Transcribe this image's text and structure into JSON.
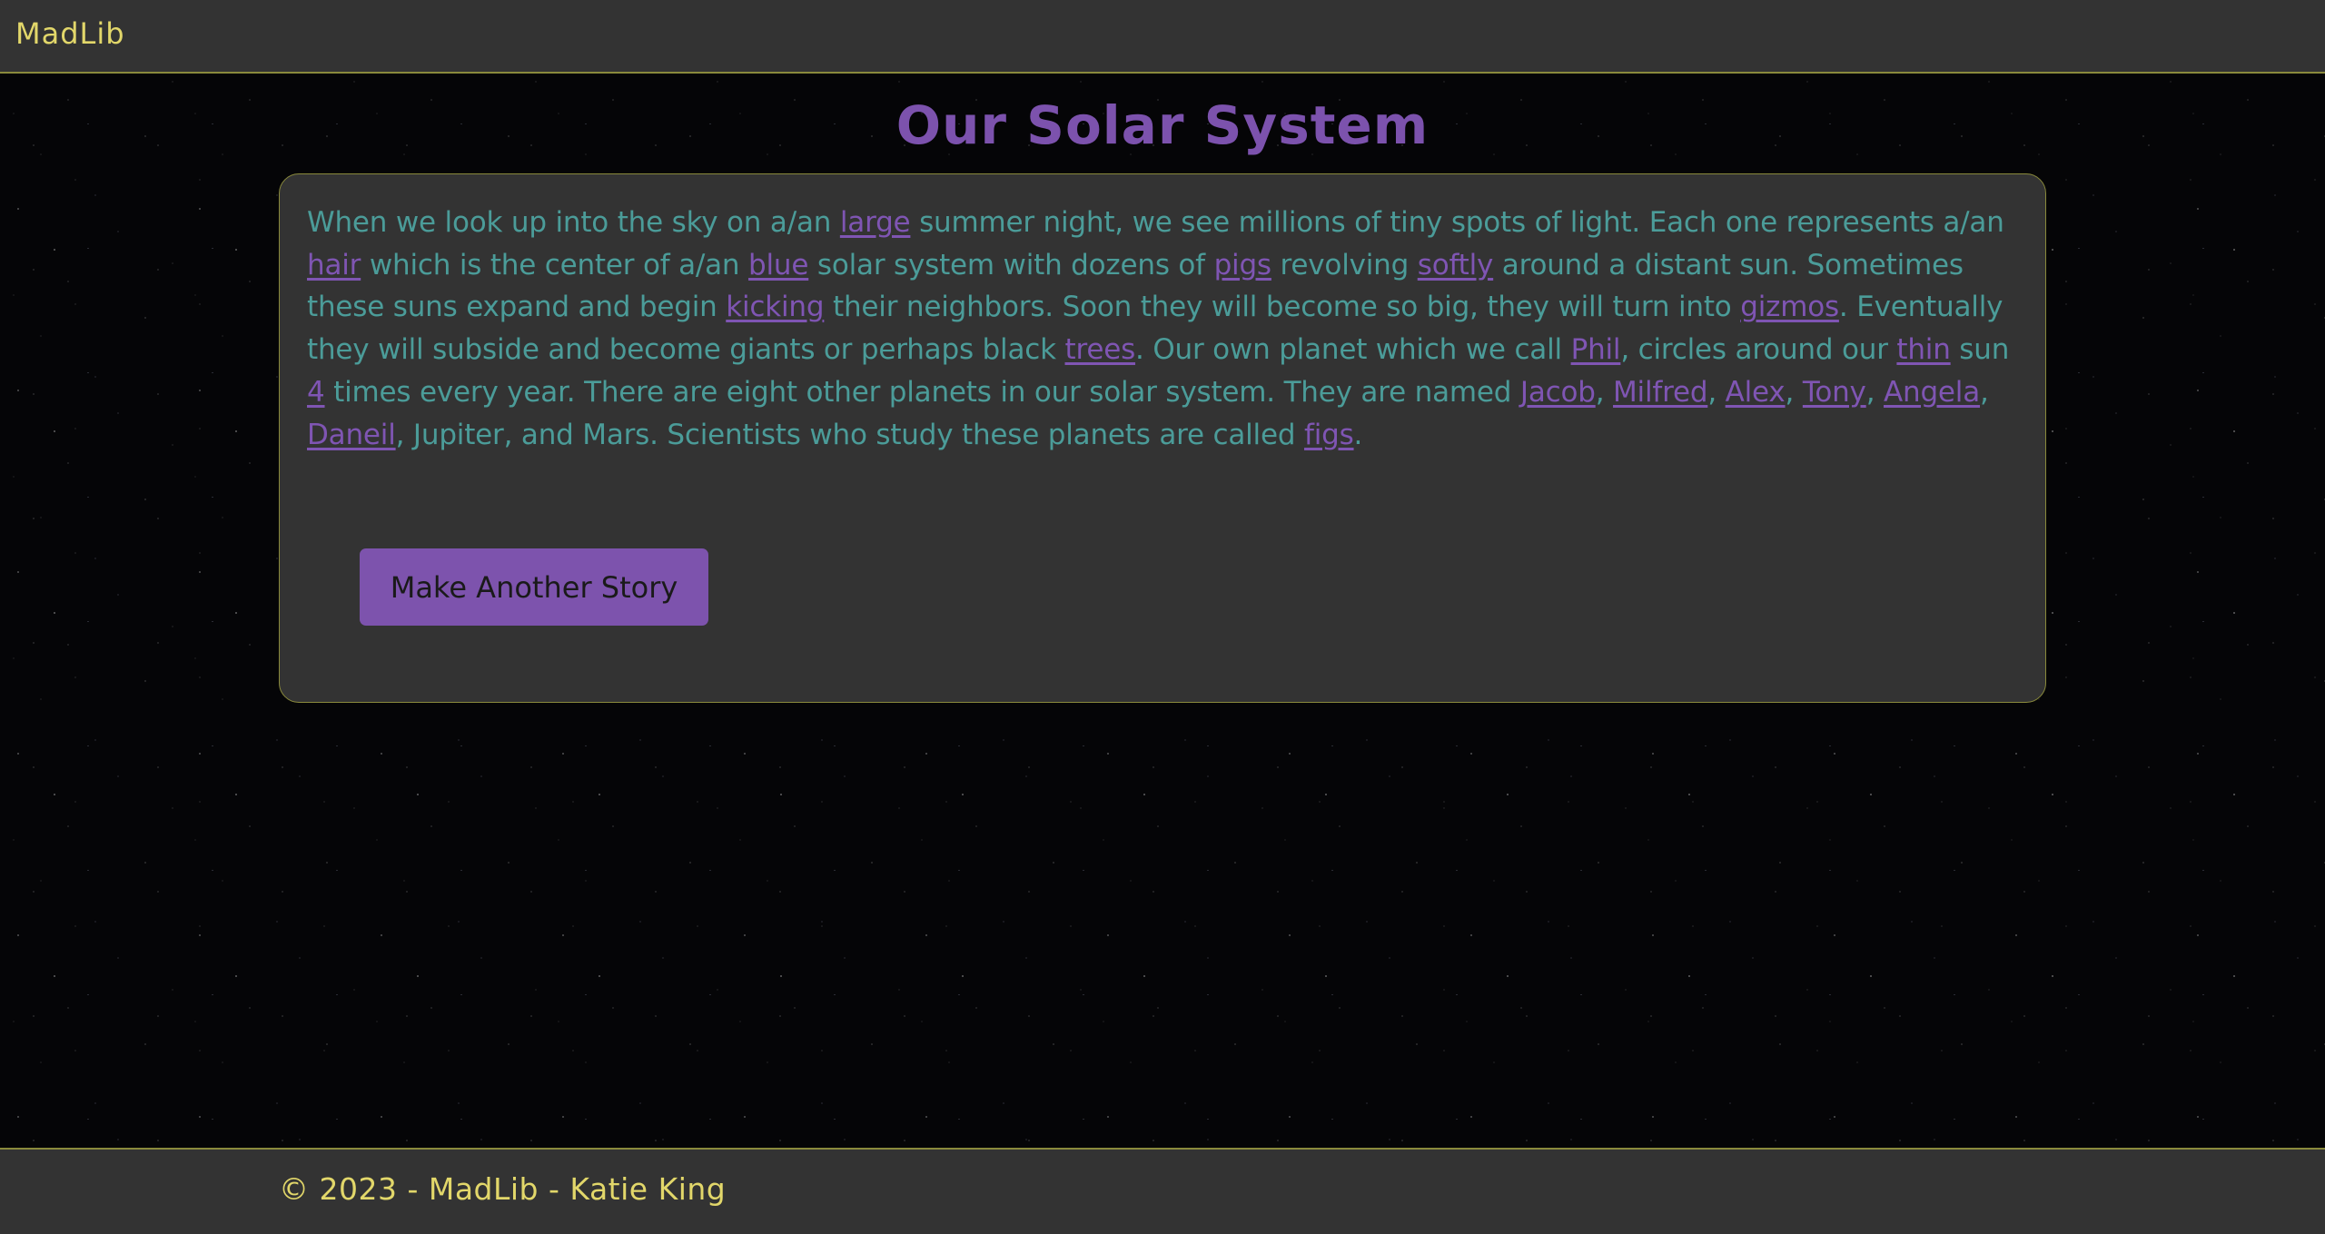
{
  "nav": {
    "brand": "MadLib"
  },
  "page": {
    "title": "Our Solar System"
  },
  "story": {
    "t1": "When we look up into the sky on a/an ",
    "w1": "large",
    "t2": " summer night, we see millions of tiny spots of light. Each one represents a/an ",
    "w2": "hair",
    "t3": " which is the center of a/an ",
    "w3": "blue",
    "t4": " solar system with dozens of ",
    "w4": "pigs",
    "t5": " revolving ",
    "w5": "softly",
    "t6": " around a distant sun. Sometimes these suns expand and begin ",
    "w6": "kicking",
    "t7": " their neighbors. Soon they will become so big, they will turn into ",
    "w7": "gizmos",
    "t8": ". Eventually they will subside and become giants or perhaps black ",
    "w8": "trees",
    "t9": ". Our own planet which we call ",
    "w9": "Phil",
    "t10": ", circles around our ",
    "w10": "thin",
    "t11": " sun ",
    "w11": "4",
    "t12": " times every year. There are eight other planets in our solar system. They are named ",
    "w12": "Jacob",
    "s1": ", ",
    "w13": "Milfred",
    "s2": ", ",
    "w14": "Alex",
    "s3": ", ",
    "w15": "Tony",
    "s4": ", ",
    "w16": "Angela",
    "s5": ", ",
    "w17": "Daneil",
    "t13": ", Jupiter, and Mars. Scientists who study these planets are called ",
    "w18": "figs",
    "t14": "."
  },
  "actions": {
    "make_another_label": "Make Another Story"
  },
  "footer": {
    "text": "© 2023 - MadLib - Katie King"
  },
  "colors": {
    "panel": "#333333",
    "accent_border": "#8a8a3c",
    "brand_yellow": "#e2d76a",
    "title_purple": "#7c52ad",
    "story_teal": "#4b9c99",
    "word_purple": "#7f55b3",
    "button_purple": "#7d53ad"
  }
}
